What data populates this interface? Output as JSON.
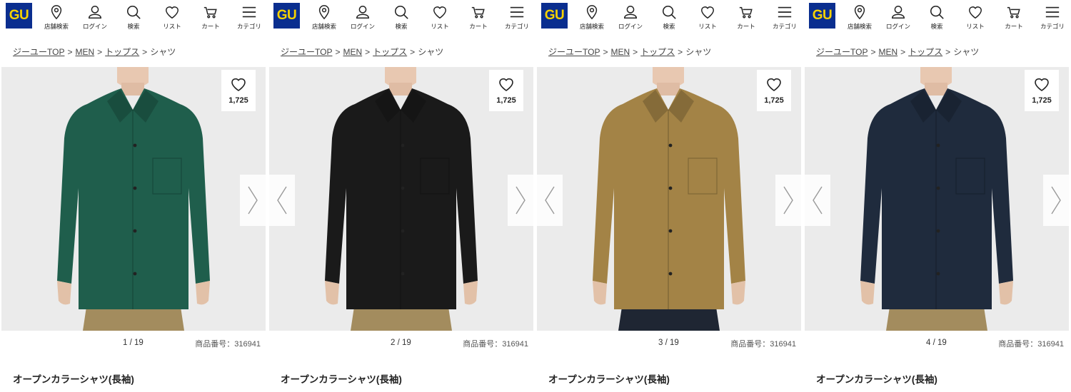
{
  "header": {
    "logo_text": "GU",
    "logo_colors": {
      "bg": "#0a2e8f",
      "text": "#f6d200"
    },
    "nav": [
      {
        "label": "店舗検索",
        "icon": "location-pin-icon"
      },
      {
        "label": "ログイン",
        "icon": "user-icon"
      },
      {
        "label": "検索",
        "icon": "search-icon"
      },
      {
        "label": "リスト",
        "icon": "heart-icon"
      },
      {
        "label": "カート",
        "icon": "cart-icon"
      },
      {
        "label": "カテゴリ",
        "icon": "menu-icon"
      }
    ]
  },
  "breadcrumb": {
    "items": [
      "ジーユーTOP",
      "MEN",
      "トップス"
    ],
    "current": "シャツ",
    "separator": ">"
  },
  "product": {
    "title": "オープンカラーシャツ(長袖)",
    "number_label": "商品番号：316941",
    "favorite_count": "1,725"
  },
  "panels": [
    {
      "counter": "1 / 19",
      "shirt_color": "#1f5e4c",
      "pants_color": "#a38c5e",
      "show_left_arrow": false
    },
    {
      "counter": "2 / 19",
      "shirt_color": "#1a1a1a",
      "pants_color": "#a38c5e",
      "show_left_arrow": true
    },
    {
      "counter": "3 / 19",
      "shirt_color": "#a38346",
      "pants_color": "#1f2633",
      "show_left_arrow": true
    },
    {
      "counter": "4 / 19",
      "shirt_color": "#1f2b3d",
      "pants_color": "#a38c5e",
      "show_left_arrow": true
    }
  ]
}
